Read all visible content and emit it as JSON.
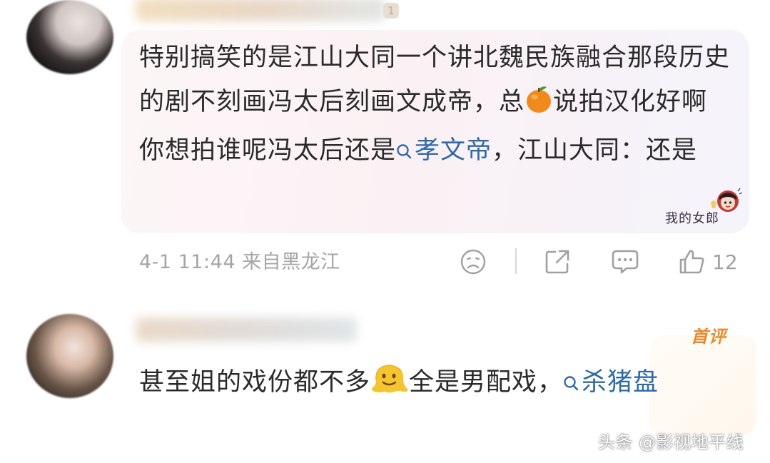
{
  "comments": [
    {
      "level_badge": "1",
      "text_before": "特别搞笑的是江山大同一个讲北魏民族融合那段历史的剧不刻画冯太后刻画文成帝，总",
      "emoji": "orange-emoji",
      "text_middle": "说拍汉化好啊你想拍谁呢冯太后还是",
      "search_link": "孝文帝",
      "text_after": "，江山大同：还是",
      "sticker_label": "我的女郎",
      "meta": "4-1 11:44 来自黑龙江",
      "like_count": "12",
      "icons": [
        "dislike-face-icon",
        "share-icon",
        "reply-icon",
        "thumbs-up-icon"
      ]
    },
    {
      "badge": "首评",
      "text_before": "甚至姐的戏份都不多",
      "emoji": "melting-face-emoji",
      "text_middle": "全是男配戏，",
      "search_link": "杀猪盘"
    }
  ],
  "watermark": "头条 @影视地平线",
  "colors": {
    "link": "#2e6aa6",
    "meta_gray": "#a5a5a5",
    "badge_orange": "#e88a2a",
    "bubble_pink": "#fbf1f4"
  }
}
